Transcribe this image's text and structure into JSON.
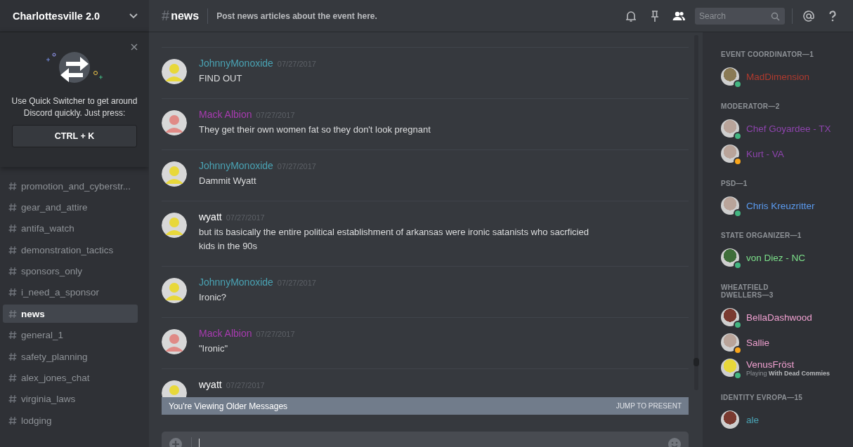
{
  "server": {
    "name": "Charlottesville 2.0"
  },
  "quick_switcher": {
    "text": "Use Quick Switcher to get around Discord quickly. Just press:",
    "shortcut": "CTRL + K"
  },
  "channels": [
    {
      "name": "promotion_and_cyberstr...",
      "selected": false
    },
    {
      "name": "gear_and_attire",
      "selected": false
    },
    {
      "name": "antifa_watch",
      "selected": false
    },
    {
      "name": "demonstration_tactics",
      "selected": false
    },
    {
      "name": "sponsors_only",
      "selected": false
    },
    {
      "name": "i_need_a_sponsor",
      "selected": false
    },
    {
      "name": "news",
      "selected": true
    },
    {
      "name": "general_1",
      "selected": false
    },
    {
      "name": "safety_planning",
      "selected": false
    },
    {
      "name": "alex_jones_chat",
      "selected": false
    },
    {
      "name": "virginia_laws",
      "selected": false
    },
    {
      "name": "lodging",
      "selected": false
    }
  ],
  "header": {
    "hash": "#",
    "channel": "news",
    "topic": "Post news articles about the event here.",
    "search_placeholder": "Search"
  },
  "messages": [
    {
      "author": "JohnnyMonoxide",
      "color": "#4aa3b4",
      "time": "07/27/2017",
      "text": "FIND OUT"
    },
    {
      "author": "Mack Albion",
      "color": "#a83bb0",
      "time": "07/27/2017",
      "text": "They get their own women fat so they don't look pregnant"
    },
    {
      "author": "JohnnyMonoxide",
      "color": "#4aa3b4",
      "time": "07/27/2017",
      "text": "Dammit Wyatt"
    },
    {
      "author": "wyatt",
      "color": "#ffffff",
      "time": "07/27/2017",
      "text": "but its basically the entire political establishment of arkansas were ironic satanists who sacrficied kids in the 90s"
    },
    {
      "author": "JohnnyMonoxide",
      "color": "#4aa3b4",
      "time": "07/27/2017",
      "text": "Ironic?"
    },
    {
      "author": "Mack Albion",
      "color": "#a83bb0",
      "time": "07/27/2017",
      "text": "\"Ironic\""
    },
    {
      "author": "wyatt",
      "color": "#ffffff",
      "time": "07/27/2017"
    }
  ],
  "older_banner": {
    "text": "You're Viewing Older Messages",
    "action": "JUMP TO PRESENT"
  },
  "member_groups": [
    {
      "title": "EVENT COORDINATOR—1",
      "members": [
        {
          "name": "MadDimension",
          "color": "#b03a2e",
          "status": {
            "color": "#43b581"
          }
        }
      ]
    },
    {
      "title": "MODERATOR—2",
      "members": [
        {
          "name": "Chef Goyardee - TX",
          "color": "#8e44ad",
          "status": {
            "color": "#43b581"
          }
        },
        {
          "name": "Kurt - VA",
          "color": "#8e44ad",
          "status": {
            "color": "#faa61a"
          }
        }
      ]
    },
    {
      "title": "PSD—1",
      "members": [
        {
          "name": "Chris Kreuzritter",
          "color": "#5b9bf0",
          "status": {
            "color": "#43b581"
          }
        }
      ]
    },
    {
      "title": "STATE ORGANIZER—1",
      "members": [
        {
          "name": "von Diez - NC",
          "color": "#7ce08a",
          "status": {
            "color": "#43b581"
          }
        }
      ]
    },
    {
      "title": "WHEATFIELD DWELLERS—3",
      "members": [
        {
          "name": "BellaDashwood",
          "color": "#f0a0d0",
          "status": {
            "color": "#43b581"
          }
        },
        {
          "name": "Sallie",
          "color": "#f0a0d0",
          "status": {
            "color": "#faa61a"
          }
        },
        {
          "name": "VenusFröst",
          "color": "#f0a0d0",
          "status": {
            "color": "#43b581"
          },
          "activity_prefix": "Playing",
          "activity": "With Dead Commies"
        }
      ]
    },
    {
      "title": "IDENTITY EVROPA—15",
      "members": [
        {
          "name": "ale",
          "color": "#4aa3b4"
        }
      ]
    }
  ]
}
